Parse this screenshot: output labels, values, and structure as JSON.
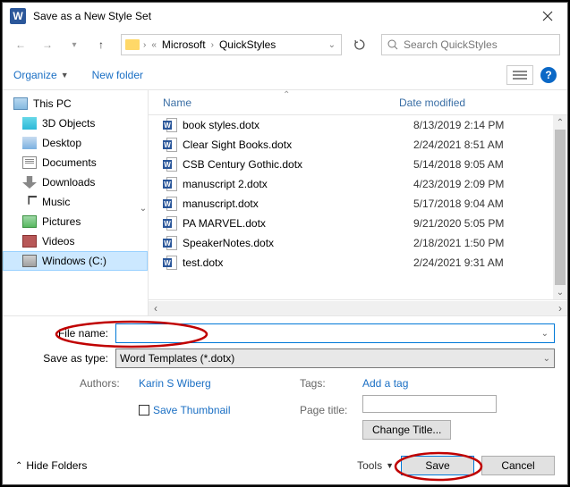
{
  "titlebar": {
    "title": "Save as a New Style Set"
  },
  "path": {
    "crumb1": "Microsoft",
    "crumb2": "QuickStyles"
  },
  "search": {
    "placeholder": "Search QuickStyles"
  },
  "toolbar": {
    "organize": "Organize",
    "newfolder": "New folder"
  },
  "sidebar": {
    "items": [
      {
        "label": "This PC"
      },
      {
        "label": "3D Objects"
      },
      {
        "label": "Desktop"
      },
      {
        "label": "Documents"
      },
      {
        "label": "Downloads"
      },
      {
        "label": "Music"
      },
      {
        "label": "Pictures"
      },
      {
        "label": "Videos"
      },
      {
        "label": "Windows (C:)"
      }
    ]
  },
  "columns": {
    "name": "Name",
    "date": "Date modified"
  },
  "files": [
    {
      "name": "book styles.dotx",
      "date": "8/13/2019 2:14 PM"
    },
    {
      "name": "Clear Sight Books.dotx",
      "date": "2/24/2021 8:51 AM"
    },
    {
      "name": "CSB Century Gothic.dotx",
      "date": "5/14/2018 9:05 AM"
    },
    {
      "name": "manuscript 2.dotx",
      "date": "4/23/2019 2:09 PM"
    },
    {
      "name": "manuscript.dotx",
      "date": "5/17/2018 9:04 AM"
    },
    {
      "name": "PA MARVEL.dotx",
      "date": "9/21/2020 5:05 PM"
    },
    {
      "name": "SpeakerNotes.dotx",
      "date": "2/18/2021 1:50 PM"
    },
    {
      "name": "test.dotx",
      "date": "2/24/2021 9:31 AM"
    }
  ],
  "form": {
    "filename_label": "File name:",
    "filename_value": "",
    "savetype_label": "Save as type:",
    "savetype_value": "Word Templates (*.dotx)",
    "authors_label": "Authors:",
    "authors_value": "Karin S Wiberg",
    "tags_label": "Tags:",
    "tags_value": "Add a tag",
    "thumbnail_label": "Save Thumbnail",
    "pagetitle_label": "Page title:",
    "pagetitle_value": "",
    "changetitle_btn": "Change Title..."
  },
  "footer": {
    "hidefolders": "Hide Folders",
    "tools": "Tools",
    "save": "Save",
    "cancel": "Cancel"
  }
}
